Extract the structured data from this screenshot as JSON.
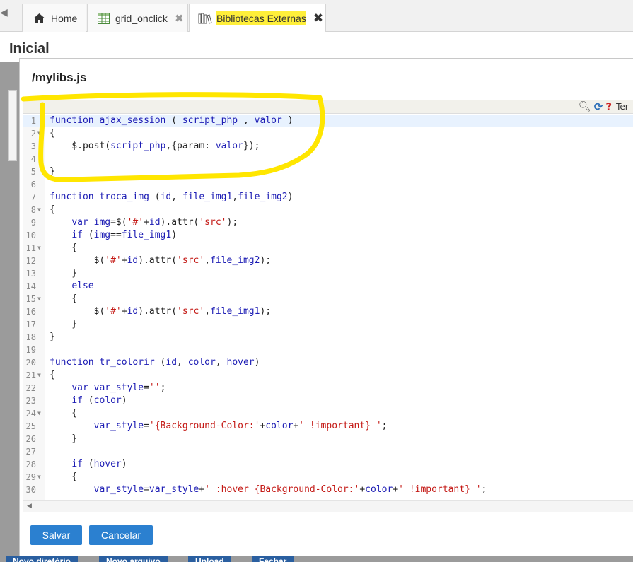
{
  "tabs": [
    {
      "label": "Home",
      "icon": "home-icon"
    },
    {
      "label": "grid_onclick",
      "icon": "grid-icon",
      "close": "✖"
    },
    {
      "label": "Bibliotecas Externas",
      "icon": "library-icon",
      "close": "✖"
    }
  ],
  "page": {
    "title": "Inicial"
  },
  "modal": {
    "title": "/mylibs.js",
    "toolbar": {
      "label": "Ter"
    },
    "buttons": {
      "save": "Salvar",
      "cancel": "Cancelar"
    }
  },
  "background_buttons": [
    "Novo diretório",
    "Novo arquivo",
    "Upload",
    "Fechar"
  ],
  "code": {
    "active_line": 1,
    "lines": [
      {
        "n": "1",
        "text": "function ajax_session ( script_php , valor )"
      },
      {
        "n": "2",
        "text": "{",
        "fold": true
      },
      {
        "n": "3",
        "text": "    $.post(script_php,{param: valor});"
      },
      {
        "n": "4",
        "text": ""
      },
      {
        "n": "5",
        "text": "}"
      },
      {
        "n": "6",
        "text": ""
      },
      {
        "n": "7",
        "text": "function troca_img (id, file_img1,file_img2)"
      },
      {
        "n": "8",
        "text": "{",
        "fold": true
      },
      {
        "n": "9",
        "text": "    var img=$('#'+id).attr('src');"
      },
      {
        "n": "10",
        "text": "    if (img==file_img1)"
      },
      {
        "n": "11",
        "text": "    {",
        "fold": true
      },
      {
        "n": "12",
        "text": "        $('#'+id).attr('src',file_img2);"
      },
      {
        "n": "13",
        "text": "    }"
      },
      {
        "n": "14",
        "text": "    else"
      },
      {
        "n": "15",
        "text": "    {",
        "fold": true
      },
      {
        "n": "16",
        "text": "        $('#'+id).attr('src',file_img1);"
      },
      {
        "n": "17",
        "text": "    }"
      },
      {
        "n": "18",
        "text": "}"
      },
      {
        "n": "19",
        "text": ""
      },
      {
        "n": "20",
        "text": "function tr_colorir (id, color, hover)"
      },
      {
        "n": "21",
        "text": "{",
        "fold": true
      },
      {
        "n": "22",
        "text": "    var var_style='';"
      },
      {
        "n": "23",
        "text": "    if (color)"
      },
      {
        "n": "24",
        "text": "    {",
        "fold": true
      },
      {
        "n": "25",
        "text": "        var_style='{Background-Color:'+color+' !important} ';"
      },
      {
        "n": "26",
        "text": "    }"
      },
      {
        "n": "27",
        "text": ""
      },
      {
        "n": "28",
        "text": "    if (hover)"
      },
      {
        "n": "29",
        "text": "    {",
        "fold": true
      },
      {
        "n": "30",
        "text": "        var_style=var_style+' :hover {Background-Color:'+color+' !important} ';"
      }
    ]
  },
  "colors": {
    "keyword": "#1c1cb4",
    "string": "#c41a16",
    "button": "#2b80d0",
    "annotation": "#ffe600",
    "active_line": "#e8f2fe"
  }
}
